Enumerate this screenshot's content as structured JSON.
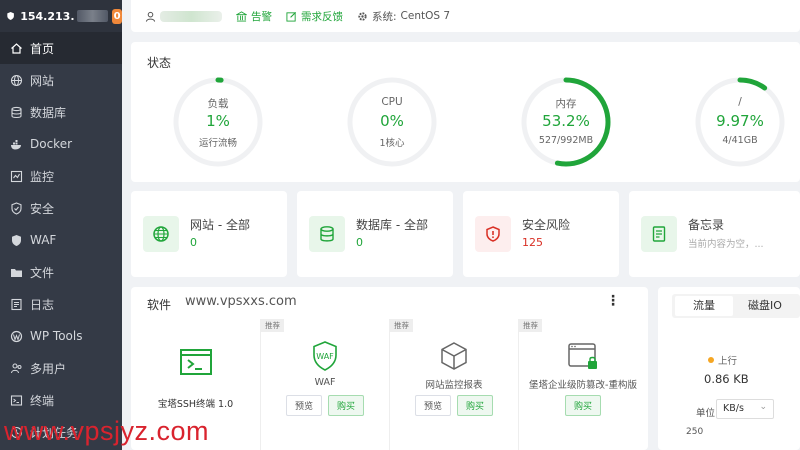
{
  "sidebar": {
    "server_ip": "154.213.",
    "badge": "0",
    "items": [
      {
        "label": "首页",
        "icon": "home-icon"
      },
      {
        "label": "网站",
        "icon": "globe-icon"
      },
      {
        "label": "数据库",
        "icon": "database-icon"
      },
      {
        "label": "Docker",
        "icon": "docker-icon"
      },
      {
        "label": "监控",
        "icon": "monitor-icon"
      },
      {
        "label": "安全",
        "icon": "shield-icon"
      },
      {
        "label": "WAF",
        "icon": "waf-icon"
      },
      {
        "label": "文件",
        "icon": "folder-icon"
      },
      {
        "label": "日志",
        "icon": "log-icon"
      },
      {
        "label": "WP Tools",
        "icon": "wordpress-icon"
      },
      {
        "label": "多用户",
        "icon": "users-icon"
      },
      {
        "label": "终端",
        "icon": "terminal-icon"
      },
      {
        "label": "计划任务",
        "icon": "clock-icon"
      }
    ]
  },
  "topbar": {
    "alert": "告警",
    "feedback": "需求反馈",
    "system_label": "系统:",
    "system_value": "CentOS 7"
  },
  "status": {
    "title": "状态",
    "gauges": [
      {
        "label": "负载",
        "value": "1%",
        "sub": "运行流畅",
        "percent": 1
      },
      {
        "label": "CPU",
        "value": "0%",
        "sub": "1核心",
        "percent": 0
      },
      {
        "label": "内存",
        "value": "53.2%",
        "sub": "527/992MB",
        "percent": 53.2
      },
      {
        "label": "/",
        "value": "9.97%",
        "sub": "4/41GB",
        "percent": 9.97
      }
    ]
  },
  "overview": [
    {
      "title": "网站 - 全部",
      "value": "0",
      "icon": "globe-icon"
    },
    {
      "title": "数据库 - 全部",
      "value": "0",
      "icon": "database-icon"
    },
    {
      "title": "安全风险",
      "value": "125",
      "icon": "security-risk-icon"
    },
    {
      "title": "备忘录",
      "value": "当前内容为空，...",
      "icon": "memo-icon"
    }
  ],
  "software": {
    "title": "软件",
    "watermark": "www.vpsxxs.com",
    "menu": "⋮",
    "items": [
      {
        "name": "宝塔SSH终端 1.0"
      },
      {
        "tag": "推荐",
        "name": "WAF",
        "preview": "预览",
        "buy": "购买"
      },
      {
        "tag": "推荐",
        "name": "网站监控报表",
        "preview": "预览",
        "buy": "购买"
      },
      {
        "tag": "推荐",
        "name": "堡塔企业级防篡改-重构版",
        "buy": "购买"
      }
    ]
  },
  "traffic": {
    "tab_traffic": "流量",
    "tab_disk": "磁盘IO",
    "up_label": "上行",
    "up_value": "0.86 KB",
    "unit_label": "单位",
    "unit_value": "KB/s",
    "y_tick": "250"
  },
  "watermark": "www.vpsjyz.com",
  "colors": {
    "accent": "#20a53a",
    "danger": "#d93025",
    "sidebar": "#343a46"
  }
}
